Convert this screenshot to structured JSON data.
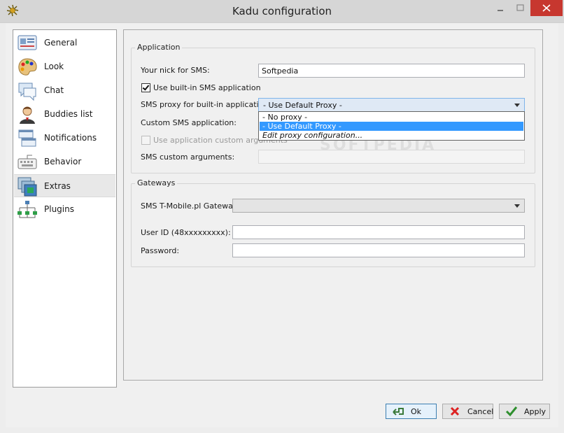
{
  "window": {
    "title": "Kadu configuration"
  },
  "sidebar": {
    "items": [
      {
        "label": "General"
      },
      {
        "label": "Look"
      },
      {
        "label": "Chat"
      },
      {
        "label": "Buddies list"
      },
      {
        "label": "Notifications"
      },
      {
        "label": "Behavior"
      },
      {
        "label": "Extras",
        "selected": true
      },
      {
        "label": "Plugins"
      }
    ]
  },
  "application": {
    "group_title": "Application",
    "nick_label": "Your nick for SMS:",
    "nick_value": "Softpedia",
    "builtin_checkbox_label": "Use built-in SMS application",
    "builtin_checked": true,
    "proxy_label": "SMS proxy for built-in application:",
    "proxy_value": "- Use Default Proxy -",
    "proxy_options": [
      "- No proxy -",
      "- Use Default Proxy -",
      "Edit proxy configuration..."
    ],
    "custom_app_label": "Custom SMS application:",
    "custom_args_checkbox_label": "Use application custom arguments",
    "custom_args_label": "SMS custom arguments:",
    "custom_args_value": ""
  },
  "gateways": {
    "group_title": "Gateways",
    "gateway_label": "SMS T-Mobile.pl Gateway:",
    "gateway_value": "",
    "userid_label": "User ID (48xxxxxxxxx):",
    "userid_value": "",
    "password_label": "Password:",
    "password_value": ""
  },
  "buttons": {
    "ok_label": "Ok",
    "cancel_label": "Cancel",
    "apply_label": "Apply"
  },
  "colors": {
    "accent_selection": "#3399ff",
    "close_button": "#c7372f"
  }
}
